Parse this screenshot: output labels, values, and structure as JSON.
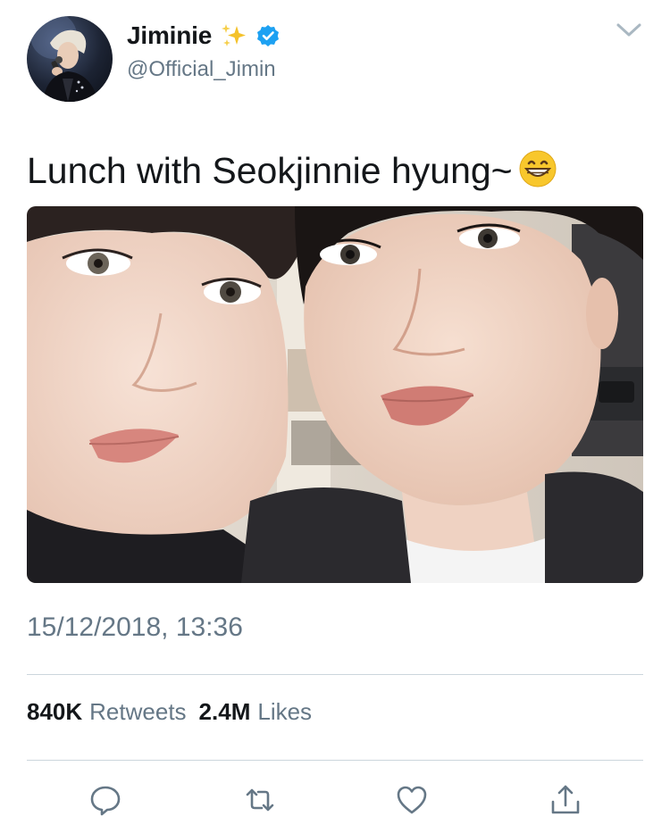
{
  "user": {
    "display_name": "Jiminie",
    "handle": "@Official_Jimin",
    "verified": true,
    "name_emoji": "sparkles-icon"
  },
  "tweet": {
    "text": "Lunch with Seokjinnie hyung~",
    "text_emoji": "grinning-face-icon",
    "timestamp": "15/12/2018, 13:36"
  },
  "stats": {
    "retweets_count": "840K",
    "retweets_label": "Retweets",
    "likes_count": "2.4M",
    "likes_label": "Likes"
  },
  "actions": [
    "reply-icon",
    "retweet-icon",
    "like-icon",
    "share-icon"
  ],
  "colors": {
    "text_primary": "#14171a",
    "text_secondary": "#657786",
    "divider": "#ccd6dd",
    "verified_blue": "#1da1f2",
    "icon_gray": "#657786"
  }
}
